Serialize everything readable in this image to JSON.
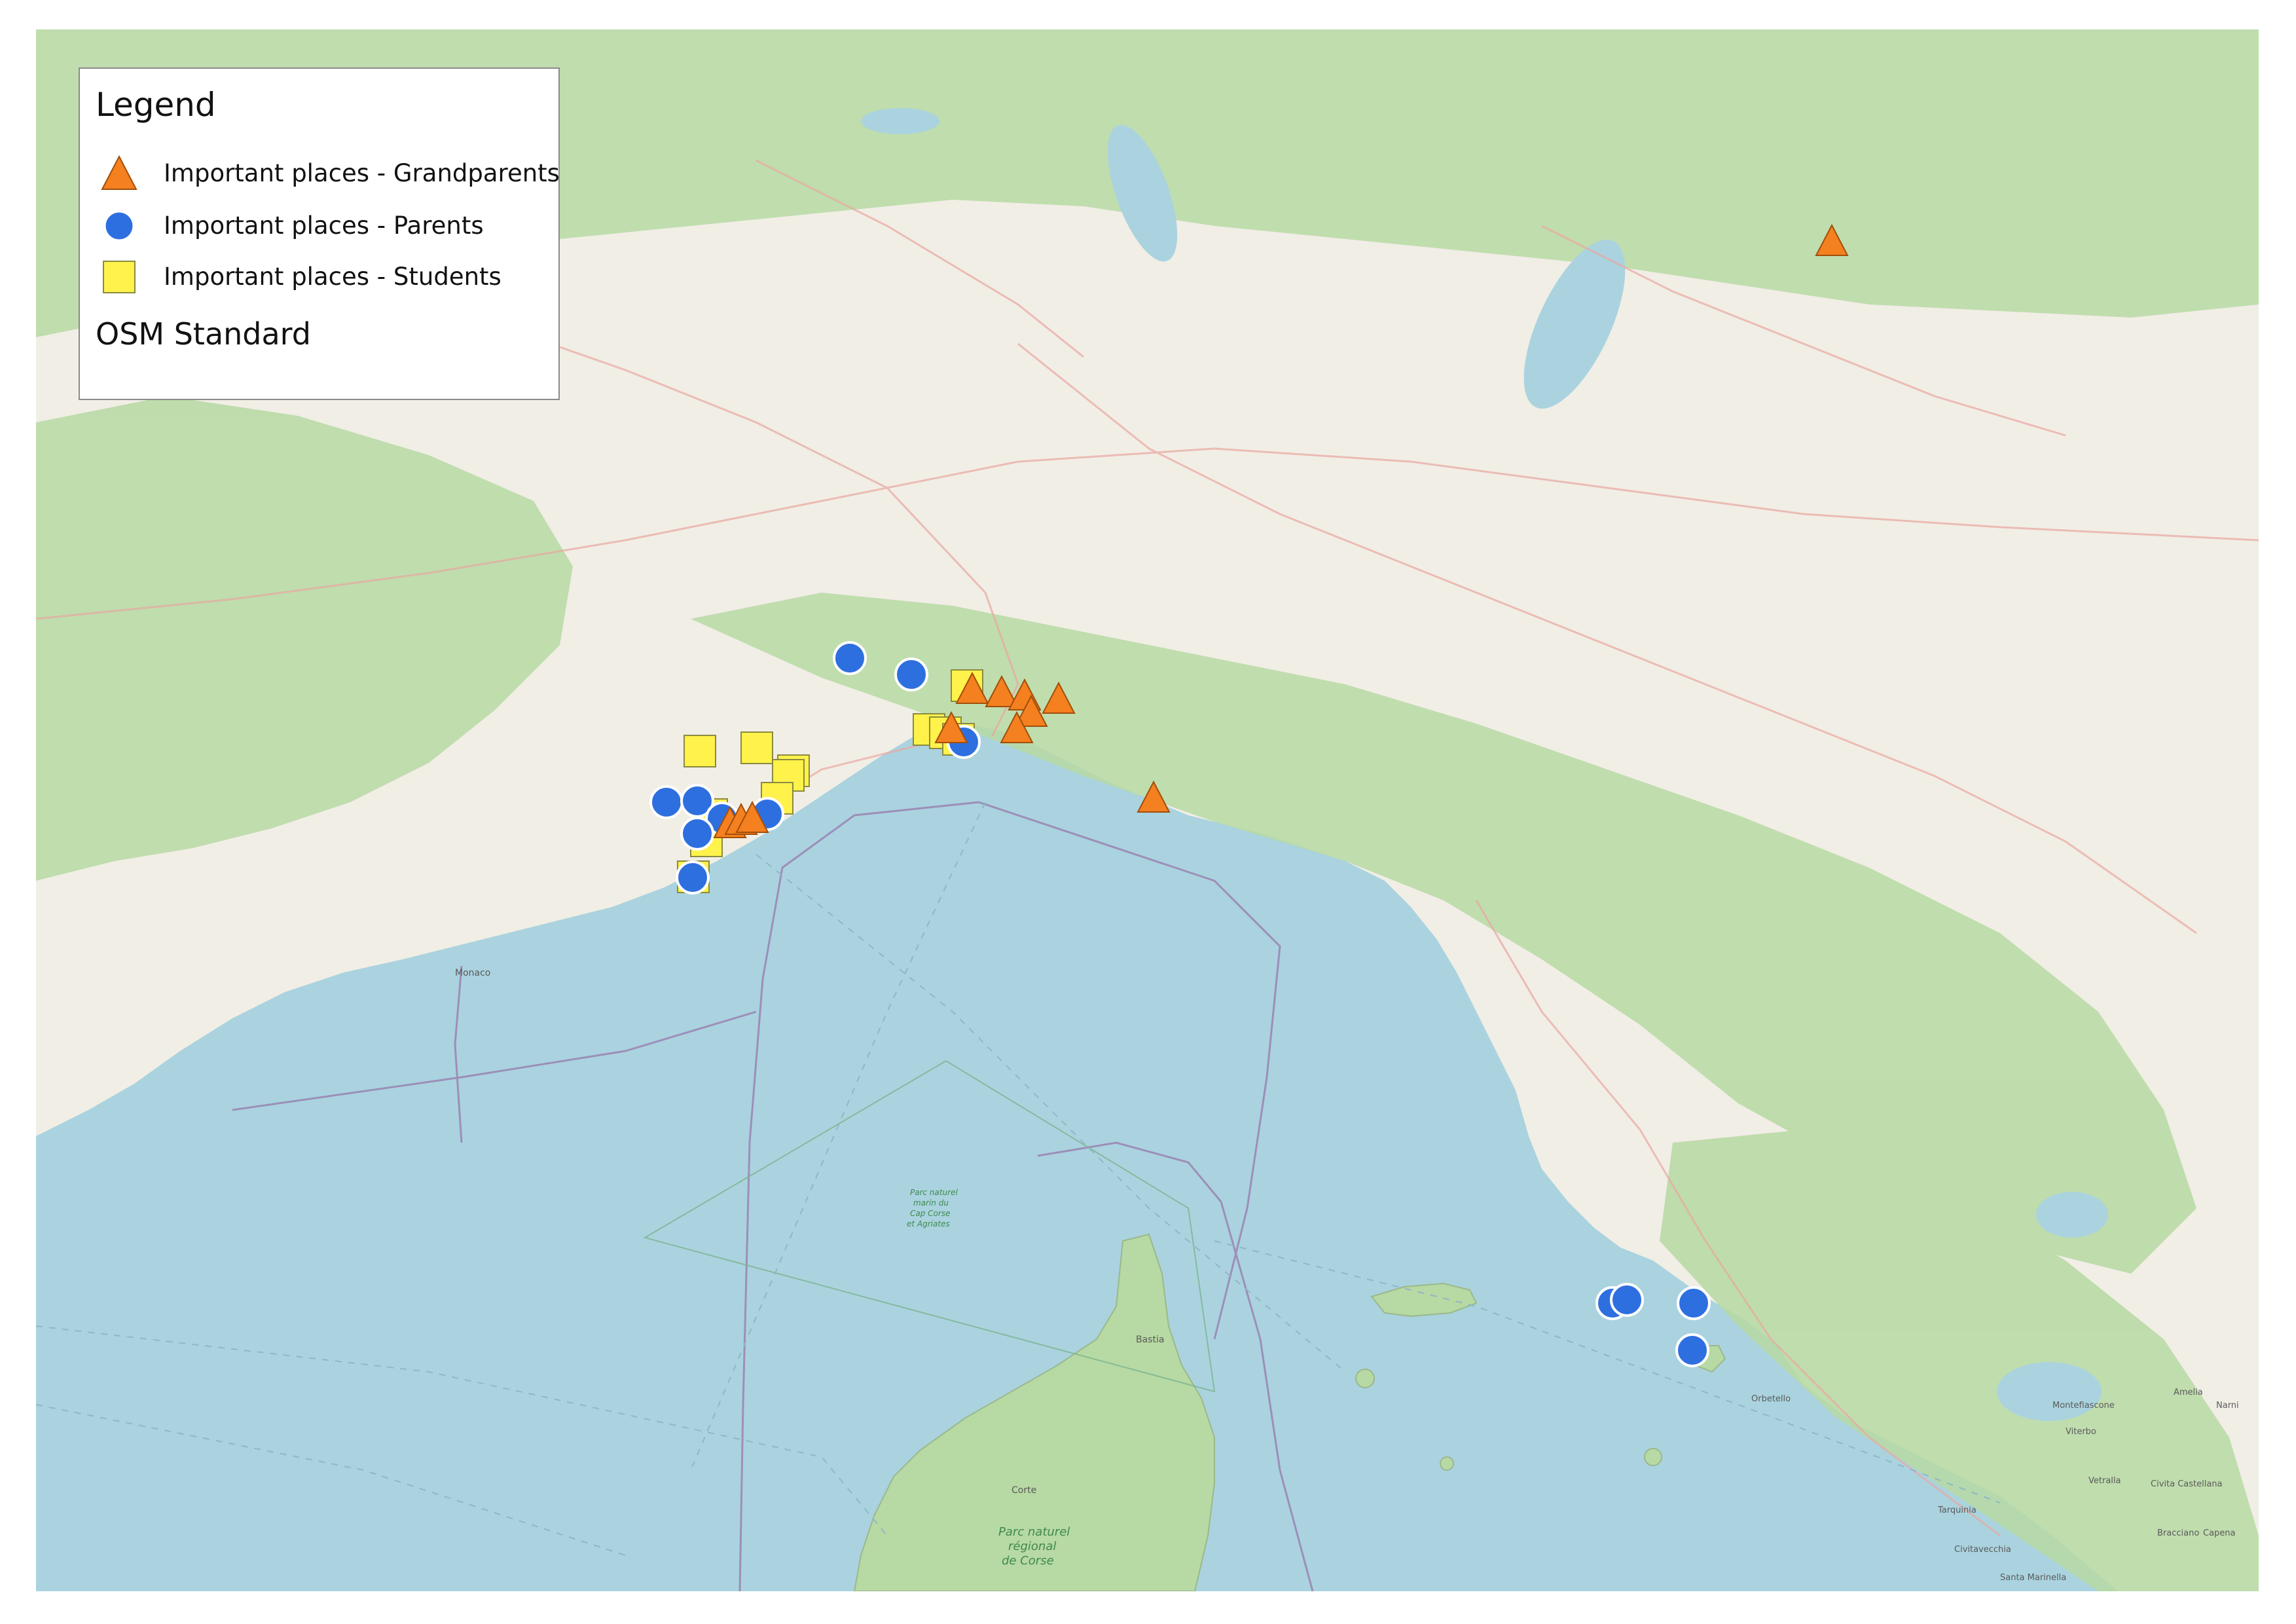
{
  "legend": {
    "title": "Legend",
    "items": [
      {
        "label": "Important places - Grandparents",
        "shape": "triangle",
        "color": "#f4801f"
      },
      {
        "label": "Important places - Parents",
        "shape": "circle",
        "color": "#2e6fe0"
      },
      {
        "label": "Important places - Students",
        "shape": "square",
        "color": "#fff24a"
      }
    ],
    "basemap_label": "OSM Standard"
  },
  "map_labels": {
    "bastia": "Bastia",
    "corte": "Corte",
    "parc_corse": [
      "Parc naturel",
      "régional",
      "de Corse"
    ],
    "orbetello": "Orbetello",
    "montefiascone": "Montefiascone",
    "viterbo": "Viterbo",
    "tarquinia": "Tarquinia",
    "vetralla": "Vetralla",
    "civita_castellana": "Civita Castellana",
    "civitavecchia": "Civitavecchia",
    "santa_marinella": "Santa Marinella",
    "amelia": "Amelia",
    "narni": "Narni",
    "bracciano": "Bracciano",
    "capena": "Capena",
    "monaco": "Monaco",
    "parc_cap_corse": [
      "Parc naturel",
      "marin du",
      "Cap Corse",
      "et Agriates"
    ]
  },
  "colors": {
    "sea": "#aad3df",
    "land": "#f1eee6",
    "forest": "#b7d9a3",
    "grandparents": "#f4801f",
    "parents": "#2e6fe0",
    "students": "#fff24a"
  },
  "icons": {
    "grandparents": "orange-triangle-icon",
    "parents": "blue-circle-icon",
    "students": "yellow-square-icon"
  }
}
